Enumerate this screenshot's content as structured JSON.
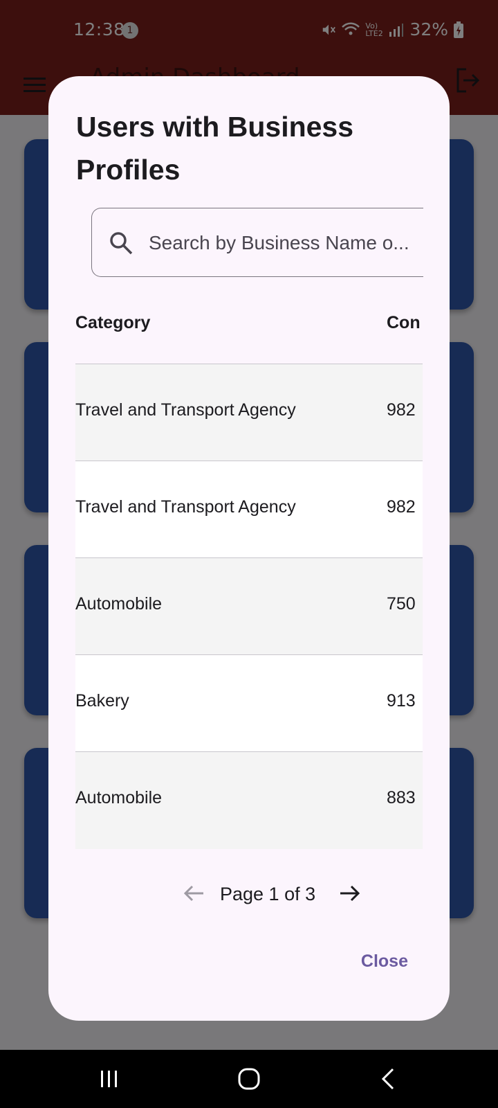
{
  "status_bar": {
    "time": "12:38",
    "notification_count": "1",
    "network_label": "Vo) LTE2",
    "battery": "32%"
  },
  "app_bar": {
    "title": "Admin Dashboard"
  },
  "dialog": {
    "title": "Users with Business Profiles",
    "search": {
      "placeholder": "Search by Business Name o..."
    },
    "table": {
      "columns": [
        "Category",
        "Con"
      ],
      "rows": [
        {
          "category": "Travel and Transport Agency",
          "contact": "982"
        },
        {
          "category": "Travel and Transport Agency",
          "contact": "982"
        },
        {
          "category": "Automobile",
          "contact": "750"
        },
        {
          "category": "Bakery",
          "contact": "913"
        },
        {
          "category": "Automobile",
          "contact": "883"
        }
      ]
    },
    "pagination": {
      "label": "Page 1 of 3"
    },
    "close_label": "Close"
  },
  "colors": {
    "app_bar": "#7a1f1a",
    "card": "#2e56a8",
    "dialog_bg": "#fcf5fd",
    "accent": "#6b5aa0"
  }
}
